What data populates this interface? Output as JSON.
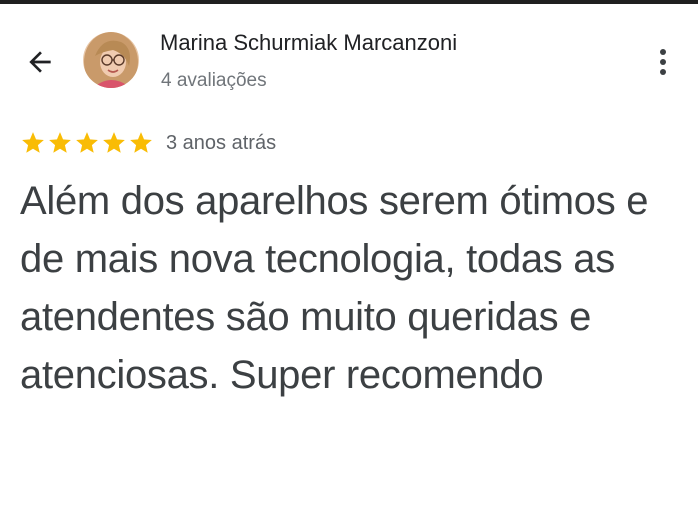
{
  "header": {
    "back_icon": "arrow-back-icon",
    "author_name": "Marina Schurmiak Marcanzoni",
    "author_reviews": "4 avaliações",
    "avatar": "profile-photo",
    "more_icon": "more-vert-icon"
  },
  "review": {
    "rating": 5,
    "rating_max": 5,
    "date": "3 anos atrás",
    "text": "Além dos aparelhos serem ótimos e de mais nova tecnologia, todas as atendentes são muito queridas e atenciosas. Super recomendo"
  },
  "colors": {
    "star": "#f9bc05",
    "text_primary": "#202124",
    "text_body": "#3c4043",
    "text_secondary": "#70757a"
  }
}
